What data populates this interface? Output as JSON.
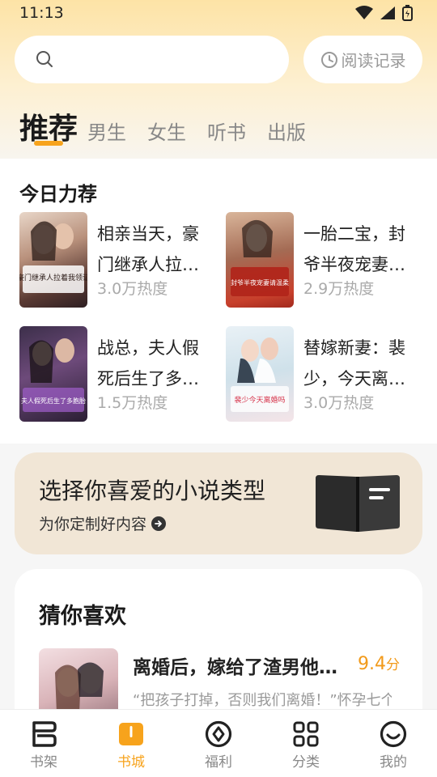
{
  "status_bar": {
    "time": "11:13"
  },
  "search": {
    "placeholder": ""
  },
  "history": {
    "label": "阅读记录"
  },
  "tabs": [
    {
      "label": "推荐",
      "active": true
    },
    {
      "label": "男生"
    },
    {
      "label": "女生"
    },
    {
      "label": "听书"
    },
    {
      "label": "出版"
    }
  ],
  "today": {
    "title": "今日力荐",
    "books": [
      {
        "title": "相亲当天，豪门继承人拉着…",
        "heat": "3.0万热度",
        "cover_text": "豪门继承人拉着我领证"
      },
      {
        "title": "一胎二宝，封爷半夜宠妻请…",
        "heat": "2.9万热度",
        "cover_text": "封爷半夜宠妻请温柔"
      },
      {
        "title": "战总，夫人假死后生了多胞…",
        "heat": "1.5万热度",
        "cover_text": "夫人假死后生了多胞胎"
      },
      {
        "title": "替嫁新妻：裴少，今天离婚…",
        "heat": "3.0万热度",
        "cover_text": "裴少今天离婚吗"
      }
    ]
  },
  "promo": {
    "title": "选择你喜爱的小说类型",
    "subtitle": "为你定制好内容"
  },
  "guess": {
    "title": "猜你喜欢",
    "item": {
      "name": "离婚后，嫁给了渣男他…",
      "score": "9.4",
      "score_unit": "分",
      "desc": "“把孩子打掉，否则我们离婚！”怀孕七个"
    }
  },
  "nav": [
    {
      "label": "书架",
      "icon": "bookshelf-icon"
    },
    {
      "label": "书城",
      "icon": "bookstore-icon",
      "active": true
    },
    {
      "label": "福利",
      "icon": "welfare-icon"
    },
    {
      "label": "分类",
      "icon": "category-icon"
    },
    {
      "label": "我的",
      "icon": "profile-icon"
    }
  ],
  "colors": {
    "accent": "#f7a31c",
    "score": "#f29a1a",
    "promo_bg": "#f1e6d6"
  }
}
